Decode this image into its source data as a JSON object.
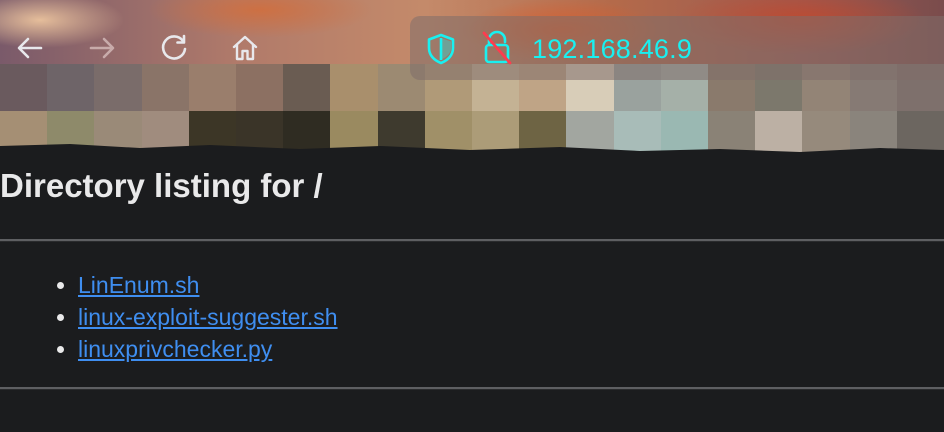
{
  "browser": {
    "back_icon": "back-arrow-icon",
    "forward_icon": "forward-arrow-icon",
    "reload_icon": "reload-icon",
    "home_icon": "home-icon",
    "shield_icon": "shield-icon",
    "insecure_lock_icon": "insecure-lock-icon",
    "url": "192.168.46.9",
    "accent_color": "#19f0f0"
  },
  "page": {
    "title": "Directory listing for /",
    "files": [
      {
        "name": "LinEnum.sh"
      },
      {
        "name": "linux-exploit-suggester.sh"
      },
      {
        "name": "linuxprivchecker.py"
      }
    ],
    "link_color": "#3f8ef0",
    "background_color": "#1b1c1e"
  }
}
